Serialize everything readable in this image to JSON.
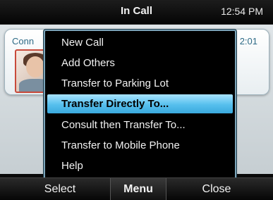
{
  "status_bar": {
    "title": "In Call",
    "time": "12:54 PM"
  },
  "call": {
    "caller_name": "Conn",
    "timer": "2:01"
  },
  "menu": {
    "items": [
      {
        "label": "New Call"
      },
      {
        "label": "Add Others"
      },
      {
        "label": "Transfer to Parking Lot"
      },
      {
        "label": "Transfer Directly To..."
      },
      {
        "label": "Consult then Transfer To..."
      },
      {
        "label": "Transfer to Mobile Phone"
      },
      {
        "label": "Help"
      }
    ],
    "selected_index": 3
  },
  "softkeys": {
    "left": "Select",
    "center": "Menu",
    "right": "Close"
  },
  "colors": {
    "highlight": "#56bfed",
    "menu_border": "#7aa3b8",
    "accent_text": "#2d6a86"
  }
}
